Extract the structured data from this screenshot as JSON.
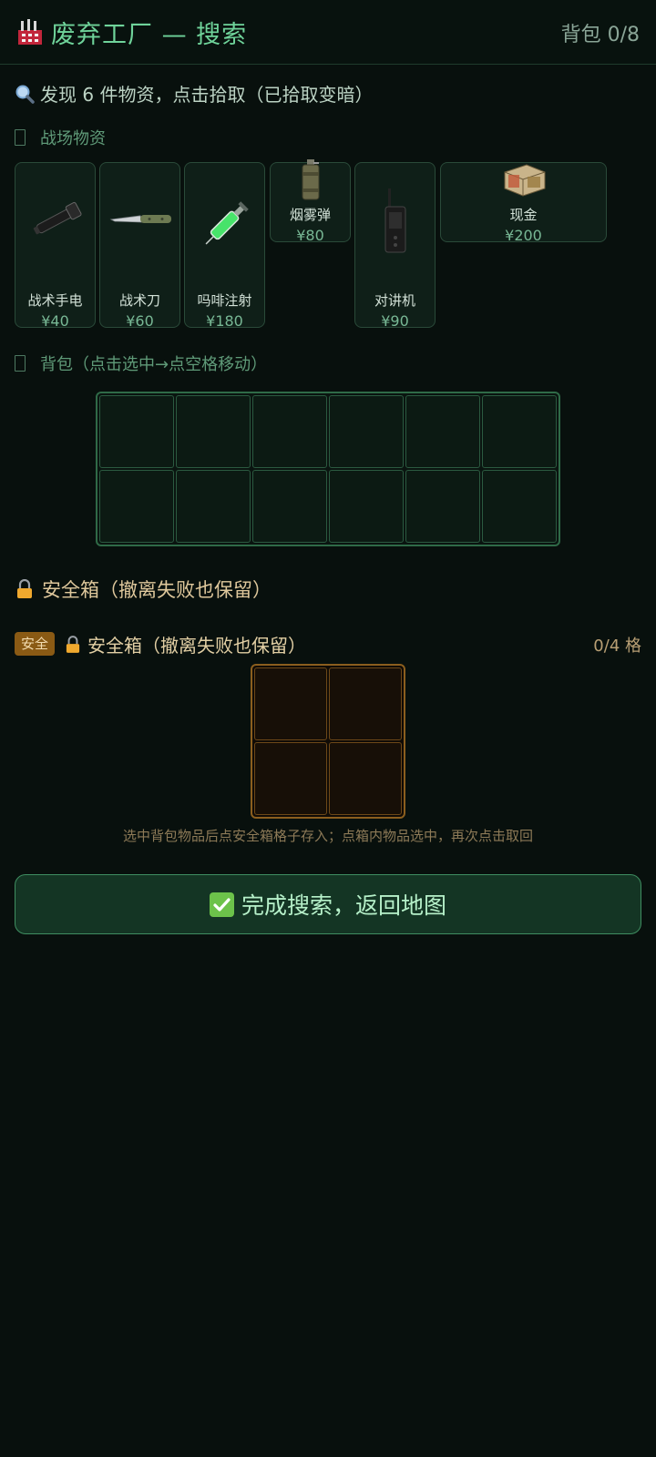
{
  "header": {
    "title": "废弃工厂 — 搜索",
    "backpack_count": "背包 0/8"
  },
  "found": {
    "text": "发现 6 件物资，点击拾取（已拾取变暗）"
  },
  "sections": {
    "battlefield_label": "战场物资",
    "backpack_label": "背包（点击选中→点空格移动）"
  },
  "loot": [
    {
      "name": "战术手电",
      "price": "¥40",
      "icon": "flashlight-icon"
    },
    {
      "name": "战术刀",
      "price": "¥60",
      "icon": "knife-icon"
    },
    {
      "name": "吗啡注射",
      "price": "¥180",
      "icon": "syringe-icon"
    },
    {
      "name": "烟雾弹",
      "price": "¥80",
      "icon": "smoke-grenade-icon"
    },
    {
      "name": "对讲机",
      "price": "¥90",
      "icon": "walkie-talkie-icon"
    },
    {
      "name": "现金",
      "price": "¥200",
      "icon": "cash-icon"
    }
  ],
  "safe": {
    "title": "安全箱（撤离失败也保留）",
    "badge": "安全",
    "subtitle": "安全箱（撤离失败也保留）",
    "capacity": "0/4 格",
    "hint": "选中背包物品后点安全箱格子存入；点箱内物品选中，再次点击取回"
  },
  "actions": {
    "done_label": "完成搜索，返回地图"
  },
  "colors": {
    "accent": "#6fd39a",
    "background": "#08100d",
    "safe_accent": "#8b5e1e"
  }
}
